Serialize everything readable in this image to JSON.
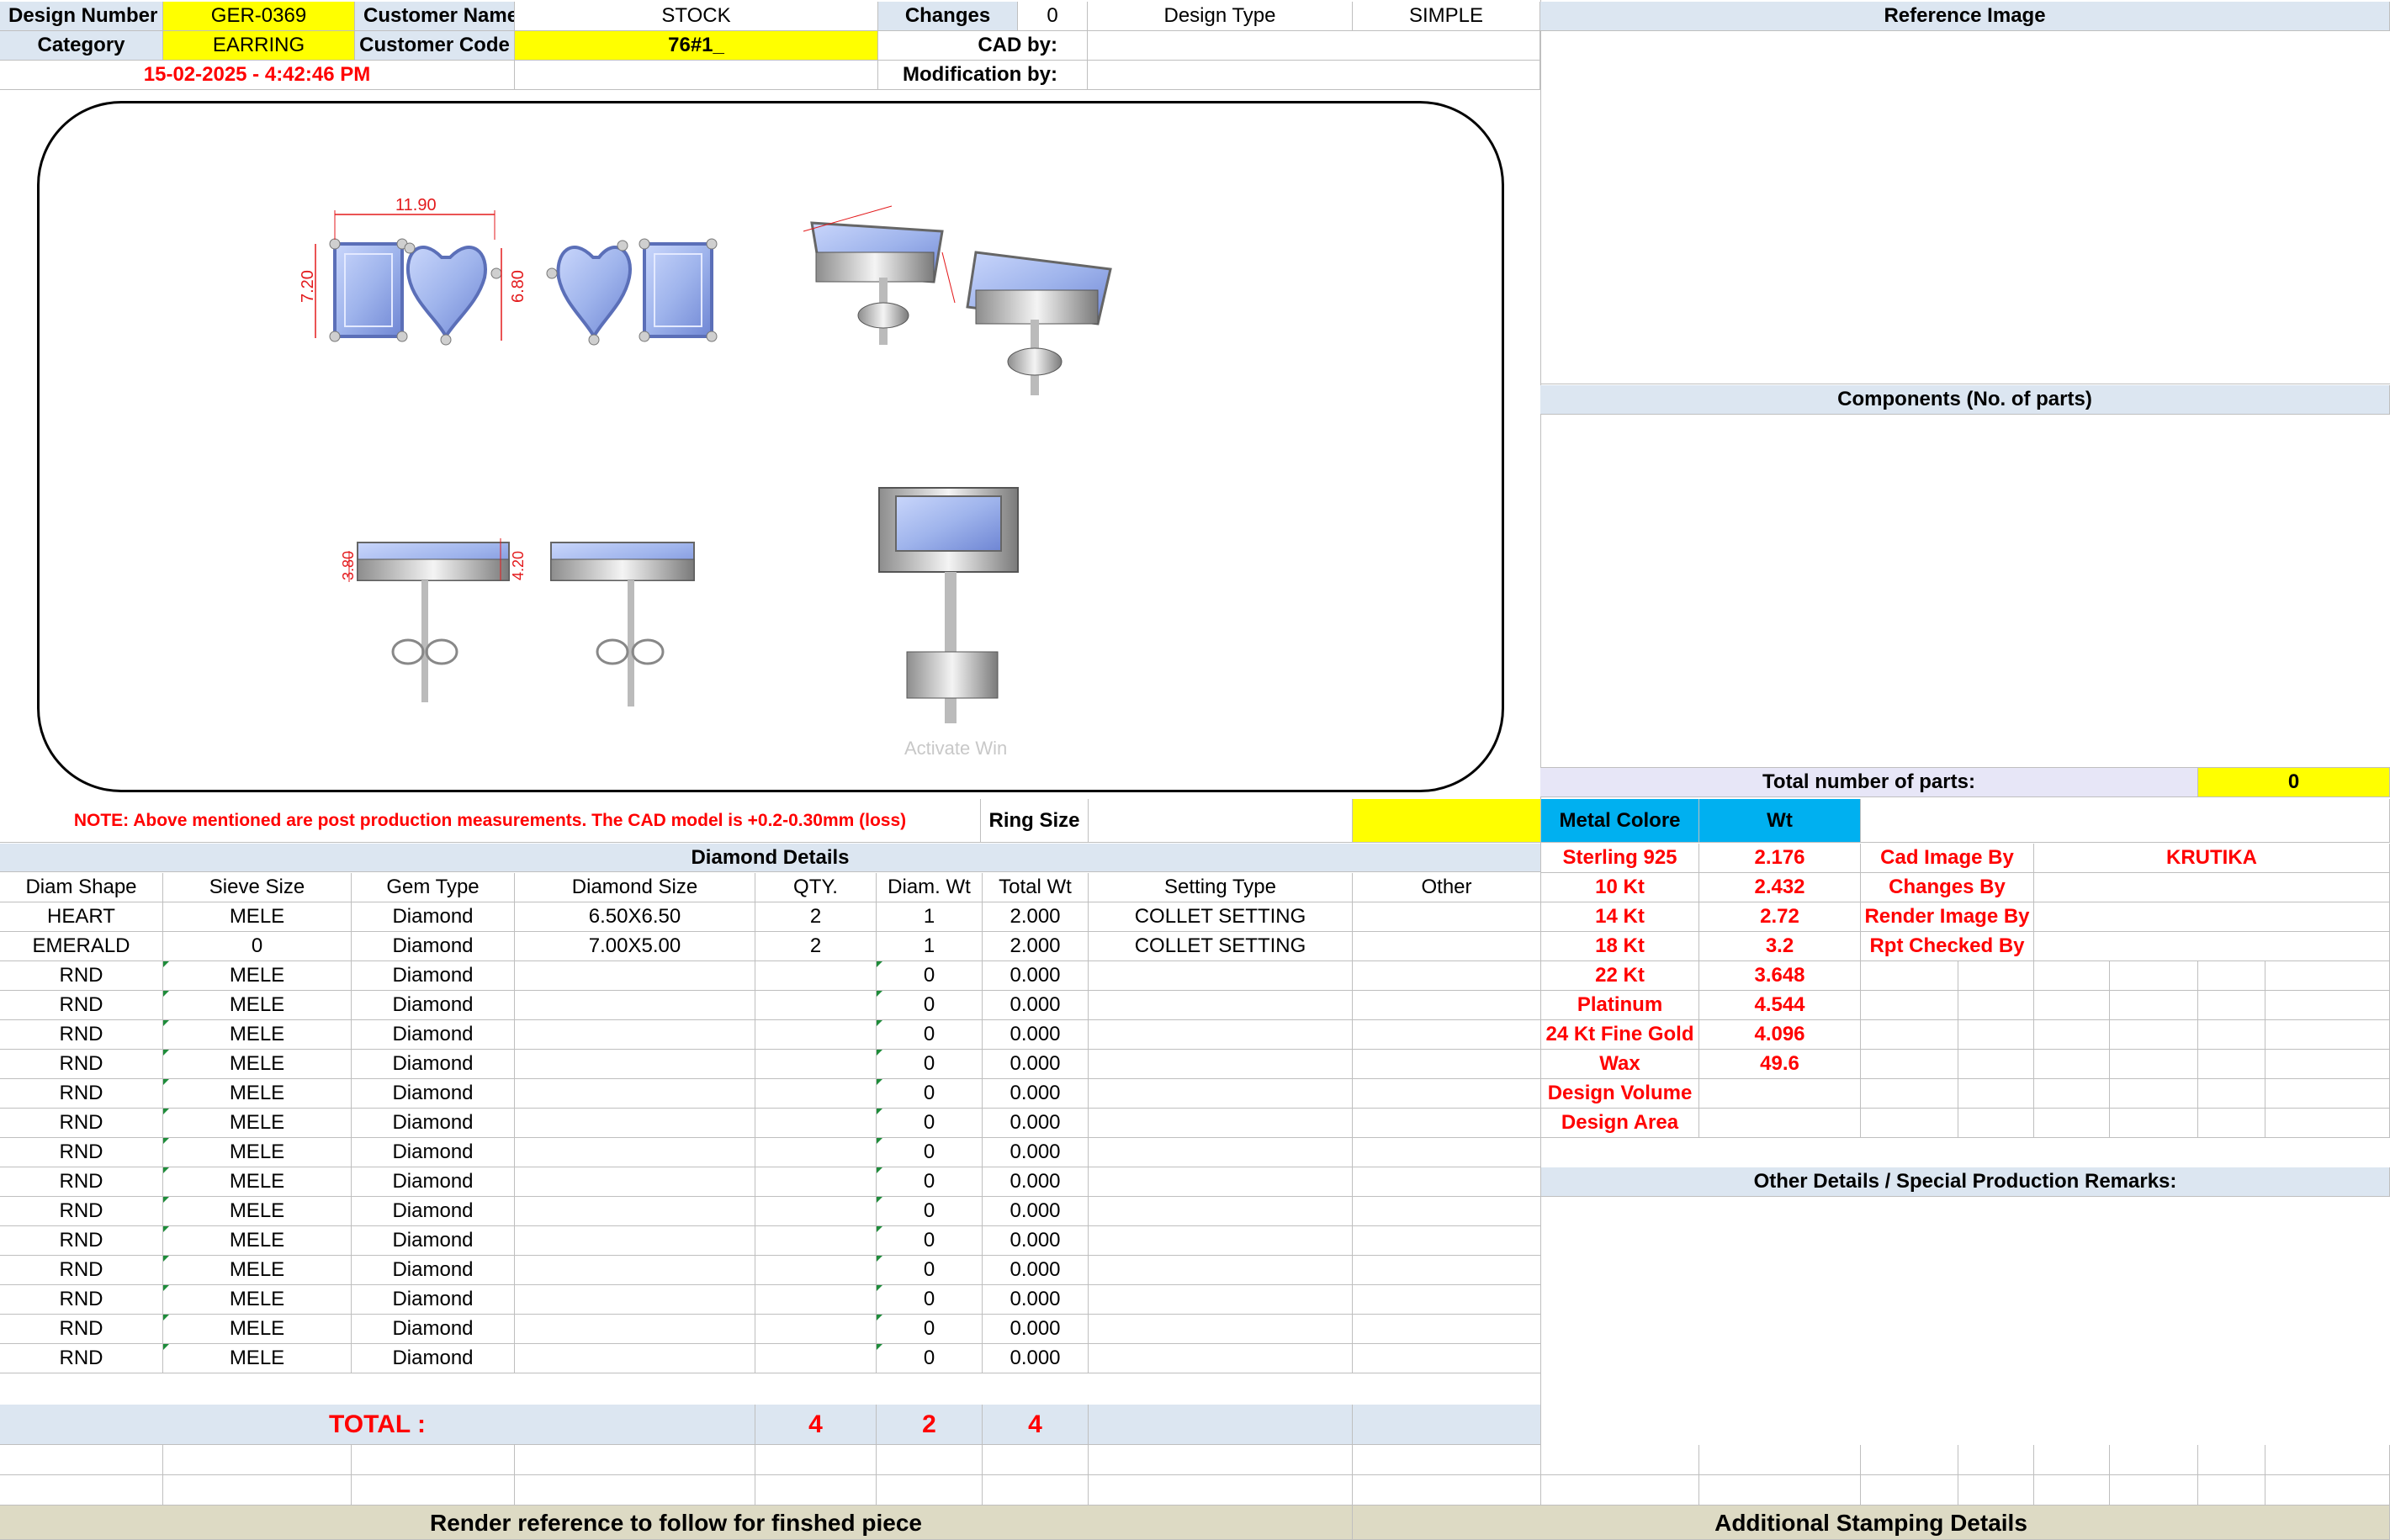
{
  "header": {
    "design_number_label": "Design Number",
    "design_number": "GER-0369",
    "customer_name_label": "Customer Name",
    "customer_name": "STOCK",
    "changes_label": "Changes",
    "changes": "0",
    "design_type_label": "Design Type",
    "design_type": "SIMPLE",
    "category_label": "Category",
    "category": "EARRING",
    "customer_code_label": "Customer Code",
    "customer_code": "76#1_",
    "cad_by_label": "CAD by:",
    "cad_by": "",
    "modification_by_label": "Modification by:",
    "modification_by": "",
    "timestamp": "15-02-2025 - 4:42:46 PM"
  },
  "render": {
    "dim_width": "11.90",
    "dim_height_left": "7.20",
    "dim_height_right": "6.80",
    "dim_side_left": "3.80",
    "dim_side_right": "4.20",
    "watermark": "Activate Win"
  },
  "right_panel": {
    "reference_image_title": "Reference Image",
    "components_title": "Components (No. of parts)",
    "total_parts_label": "Total number of parts:",
    "total_parts": "0"
  },
  "note": {
    "text": "NOTE: Above mentioned are post production measurements. The CAD model is +0.2-0.30mm (loss)",
    "ring_size_label": "Ring Size",
    "ring_size": ""
  },
  "diamond": {
    "title": "Diamond Details",
    "headers": [
      "Diam Shape",
      "Sieve Size",
      "Gem Type",
      "Diamond Size",
      "QTY.",
      "Diam. Wt",
      "Total Wt",
      "Setting Type",
      "Other"
    ],
    "rows": [
      [
        "HEART",
        "MELE",
        "Diamond",
        "6.50X6.50",
        "2",
        "1",
        "2.000",
        "COLLET SETTING",
        ""
      ],
      [
        "EMERALD",
        "0",
        "Diamond",
        "7.00X5.00",
        "2",
        "1",
        "2.000",
        "COLLET SETTING",
        ""
      ],
      [
        "RND",
        "MELE",
        "Diamond",
        "",
        "",
        "0",
        "0.000",
        "",
        ""
      ],
      [
        "RND",
        "MELE",
        "Diamond",
        "",
        "",
        "0",
        "0.000",
        "",
        ""
      ],
      [
        "RND",
        "MELE",
        "Diamond",
        "",
        "",
        "0",
        "0.000",
        "",
        ""
      ],
      [
        "RND",
        "MELE",
        "Diamond",
        "",
        "",
        "0",
        "0.000",
        "",
        ""
      ],
      [
        "RND",
        "MELE",
        "Diamond",
        "",
        "",
        "0",
        "0.000",
        "",
        ""
      ],
      [
        "RND",
        "MELE",
        "Diamond",
        "",
        "",
        "0",
        "0.000",
        "",
        ""
      ],
      [
        "RND",
        "MELE",
        "Diamond",
        "",
        "",
        "0",
        "0.000",
        "",
        ""
      ],
      [
        "RND",
        "MELE",
        "Diamond",
        "",
        "",
        "0",
        "0.000",
        "",
        ""
      ],
      [
        "RND",
        "MELE",
        "Diamond",
        "",
        "",
        "0",
        "0.000",
        "",
        ""
      ],
      [
        "RND",
        "MELE",
        "Diamond",
        "",
        "",
        "0",
        "0.000",
        "",
        ""
      ],
      [
        "RND",
        "MELE",
        "Diamond",
        "",
        "",
        "0",
        "0.000",
        "",
        ""
      ],
      [
        "RND",
        "MELE",
        "Diamond",
        "",
        "",
        "0",
        "0.000",
        "",
        ""
      ],
      [
        "RND",
        "MELE",
        "Diamond",
        "",
        "",
        "0",
        "0.000",
        "",
        ""
      ],
      [
        "RND",
        "MELE",
        "Diamond",
        "",
        "",
        "0",
        "0.000",
        "",
        ""
      ]
    ],
    "total_label": "TOTAL :",
    "total_qty": "4",
    "total_diam_wt": "2",
    "total_wt": "4"
  },
  "metal": {
    "header_label": "Metal Colore",
    "header_wt": "Wt",
    "rows": [
      {
        "label": "Sterling 925",
        "wt": "2.176"
      },
      {
        "label": "10 Kt",
        "wt": "2.432"
      },
      {
        "label": "14 Kt",
        "wt": "2.72"
      },
      {
        "label": "18 Kt",
        "wt": "3.2"
      },
      {
        "label": "22 Kt",
        "wt": "3.648"
      },
      {
        "label": "Platinum",
        "wt": "4.544"
      },
      {
        "label": "24 Kt Fine Gold",
        "wt": "4.096"
      },
      {
        "label": "Wax",
        "wt": "49.6"
      },
      {
        "label": "Design Volume",
        "wt": ""
      },
      {
        "label": "Design Area",
        "wt": ""
      }
    ]
  },
  "credits": {
    "rows": [
      {
        "label": "Cad Image By",
        "value": "KRUTIKA"
      },
      {
        "label": "Changes By",
        "value": ""
      },
      {
        "label": "Render Image By",
        "value": ""
      },
      {
        "label": "Rpt Checked By",
        "value": ""
      }
    ]
  },
  "other_details_title": "Other Details / Special Production Remarks:",
  "footer": {
    "render_reference": "Render reference to follow for finshed piece",
    "stamping": "Additional Stamping Details"
  },
  "colors": {
    "yellow": "#ffff00",
    "header_blue": "#dce6f1",
    "metal_blue": "#00b0f0",
    "red": "#ff0000",
    "footer_tan": "#dddac4",
    "gem_blue": "#9fb4ec"
  }
}
